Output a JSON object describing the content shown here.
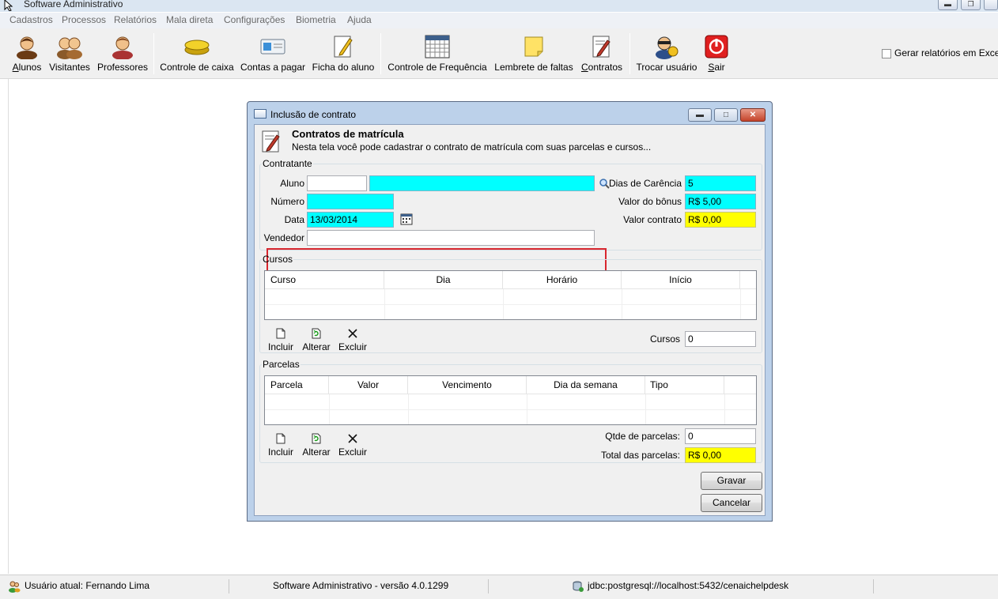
{
  "app": {
    "title": "Software Administrativo"
  },
  "menu": [
    "Cadastros",
    "Processos",
    "Relatórios",
    "Mala direta",
    "Configurações",
    "Biometria",
    "Ajuda"
  ],
  "toolbar": {
    "alunos": "Alunos",
    "visitantes": "Visitantes",
    "professores": "Professores",
    "controle_caixa": "Controle de caixa",
    "contas_pagar": "Contas a pagar",
    "ficha_aluno": "Ficha do aluno",
    "controle_frequencia": "Controle de Frequência",
    "lembrete_faltas": "Lembrete de faltas",
    "contratos": "Contratos",
    "trocar_usuario": "Trocar usuário",
    "sair": "Sair",
    "excel_label": "Gerar relatórios em Excel",
    "excel_checked": false
  },
  "dialog": {
    "title": "Inclusão de contrato",
    "header_title": "Contratos de matrícula",
    "header_desc": "Nesta tela você pode cadastrar o contrato de matrícula com suas parcelas e cursos...",
    "contratante_legend": "Contratante",
    "aluno_label": "Aluno",
    "aluno_code": "",
    "aluno_name": "",
    "numero_label": "Número",
    "numero_value": "",
    "data_label": "Data",
    "data_value": "13/03/2014",
    "vendedor_label": "Vendedor",
    "vendedor_value": "",
    "dias_carencia_label": "Dias de Carência",
    "dias_carencia_value": "5",
    "valor_bonus_label": "Valor do bônus",
    "valor_bonus_value": "R$ 5,00",
    "valor_contrato_label": "Valor contrato",
    "valor_contrato_value": "R$ 0,00",
    "cursos_legend": "Cursos",
    "cursos_columns": [
      "Curso",
      "Dia",
      "Horário",
      "Início"
    ],
    "cursos_count_label": "Cursos",
    "cursos_count_value": "0",
    "parcelas_legend": "Parcelas",
    "parcelas_columns": [
      "Parcela",
      "Valor",
      "Vencimento",
      "Dia da semana",
      "Tipo"
    ],
    "qtde_parcelas_label": "Qtde de parcelas:",
    "qtde_parcelas_value": "0",
    "total_parcelas_label": "Total das parcelas:",
    "total_parcelas_value": "R$ 0,00",
    "incluir": "Incluir",
    "alterar": "Alterar",
    "excluir": "Excluir",
    "gravar": "Gravar",
    "cancelar": "Cancelar"
  },
  "status": {
    "usuario": "Usuário atual: Fernando Lima",
    "versao": "Software Administrativo - versão 4.0.1299",
    "jdbc": "jdbc:postgresql://localhost:5432/cenaichelpdesk"
  },
  "colors": {
    "required_field": "#00ffff",
    "computed_field": "#ffff00",
    "highlight": "#d8262e"
  }
}
